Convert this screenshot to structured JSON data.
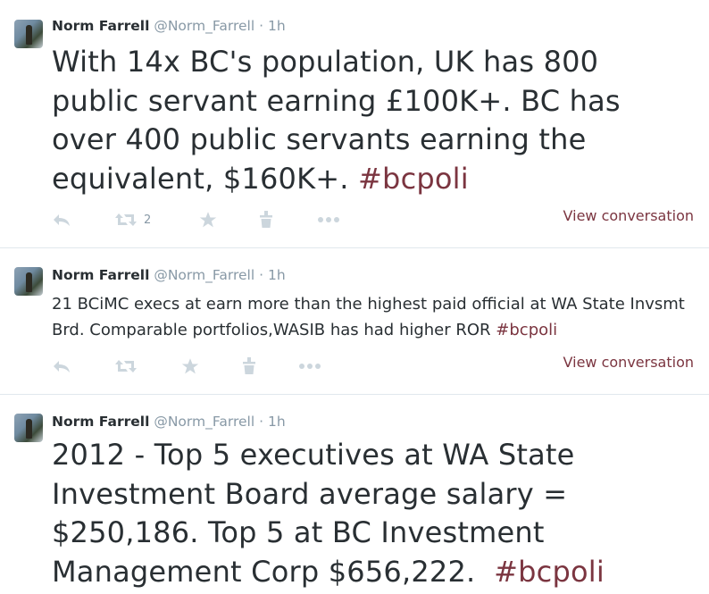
{
  "tweets": [
    {
      "name": "Norm Farrell",
      "handle": "@Norm_Farrell",
      "separator": "·",
      "time": "1h",
      "text": "With 14x BC's population, UK has 800 public servant earning £100K+. BC has over 400 public servants earning the equivalent, $160K+. ",
      "hashtag": "#bcpoli",
      "retweet_count": "2",
      "view_conversation": "View conversation"
    },
    {
      "name": "Norm Farrell",
      "handle": "@Norm_Farrell",
      "separator": "·",
      "time": "1h",
      "text": "21 BCiMC execs at earn more than the highest paid official at WA State Invsmt Brd. Comparable portfolios,WASIB has had higher ROR ",
      "hashtag": "#bcpoli",
      "retweet_count": "",
      "view_conversation": "View conversation"
    },
    {
      "name": "Norm Farrell",
      "handle": "@Norm_Farrell",
      "separator": "·",
      "time": "1h",
      "text": "2012 - Top 5 executives at WA State Investment Board average salary = $250,186. Top 5 at BC Investment Management Corp $656,222.  ",
      "hashtag": "#bcpoli"
    }
  ],
  "icons": {
    "reply": "reply-icon",
    "retweet": "retweet-icon",
    "favorite": "star-icon",
    "pocket": "pocket-icon",
    "more": "more-icon"
  },
  "colors": {
    "hashtag": "#7b3540",
    "meta": "#8899a6",
    "action": "#ccd6dd"
  }
}
